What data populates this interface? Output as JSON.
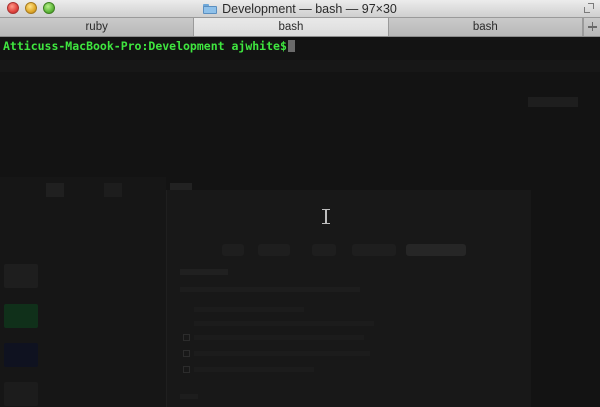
{
  "window": {
    "title": "Development — bash — 97×30"
  },
  "tabs": [
    {
      "label": "ruby",
      "active": false
    },
    {
      "label": "bash",
      "active": true
    },
    {
      "label": "bash",
      "active": false
    }
  ],
  "terminal": {
    "prompt": "Atticuss-MacBook-Pro:Development ajwhite$",
    "prompt_color": "#3fe63f"
  },
  "icons": [
    "close-icon",
    "minimize-icon",
    "zoom-icon",
    "folder-icon",
    "fullscreen-icon",
    "new-tab-icon",
    "text-cursor-icon"
  ]
}
